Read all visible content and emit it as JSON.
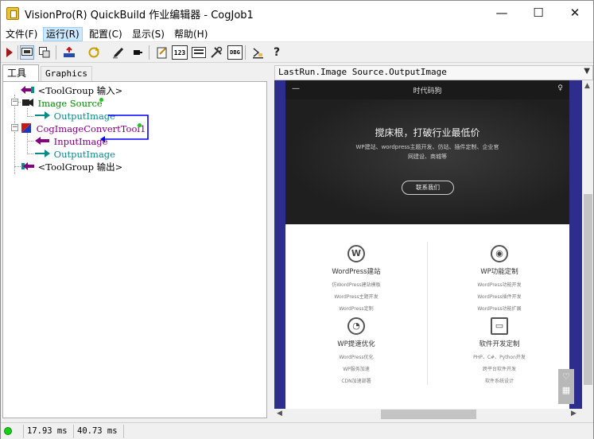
{
  "window": {
    "title": "VisionPro(R) QuickBuild 作业编辑器 - CogJob1",
    "minimize": "—",
    "maximize": "☐",
    "close": "✕"
  },
  "menu": {
    "items": [
      {
        "label": "文件(F)"
      },
      {
        "label": "运行(R)"
      },
      {
        "label": "配置(C)"
      },
      {
        "label": "显示(S)"
      },
      {
        "label": "帮助(H)"
      }
    ]
  },
  "toolbar": {
    "icons": [
      "run-icon",
      "image-view-icon",
      "image-select-icon",
      "reset-icon",
      "loop-icon",
      "pen-icon",
      "record-icon",
      "edit-icon",
      "counter-icon",
      "image-display-icon",
      "tools-icon",
      "debug-icon",
      "terminal-icon",
      "help-icon"
    ],
    "counter_label": "123",
    "debug_label": "DBG",
    "help_label": "?"
  },
  "left_panel": {
    "tab_tools": "工具",
    "tab_graphics": "Graphics",
    "tree": {
      "toolgroup_input": "<ToolGroup 输入>",
      "image_source": "Image Source",
      "image_source_output": "OutputImage",
      "convert_tool": "CogImageConvertTool1",
      "convert_input": "InputImage",
      "convert_output": "OutputImage",
      "toolgroup_output": "<ToolGroup 输出>"
    }
  },
  "right_panel": {
    "header": "LastRun.Image Source.OutputImage",
    "web": {
      "nav_title": "时代码狗",
      "hero_title": "搅床根，打破行业最低价",
      "hero_sub_1": "WP建站、wordpress主题开发、仿站、插件定制、企业官",
      "hero_sub_2": "网建设、商城等",
      "hero_button": "联系我们",
      "services": [
        {
          "title": "WordPress建站",
          "lines": [
            "仿WordPress建站模板",
            "WordPress主题开发",
            "WordPress定制"
          ]
        },
        {
          "title": "WP功能定制",
          "lines": [
            "WordPress功能开发",
            "WordPress插件开发",
            "WordPress功能扩展"
          ]
        },
        {
          "title": "WP提速优化",
          "lines": [
            "WordPress优化",
            "WP服务加速",
            "CDN加速部署"
          ]
        },
        {
          "title": "软件开发定制",
          "lines": [
            "PHP、C#、Python开发",
            "跨平台软件开发",
            "软件系统设计"
          ]
        }
      ]
    }
  },
  "status": {
    "time1": "17.93 ms",
    "time2": "40.73 ms"
  },
  "colors": {
    "tree_green": "#008a00",
    "tree_teal": "#0b8a8a",
    "tree_purple": "#800080",
    "link_blue": "#0000ff",
    "image_bg": "#2d2d8e",
    "status_led": "#18d018"
  }
}
